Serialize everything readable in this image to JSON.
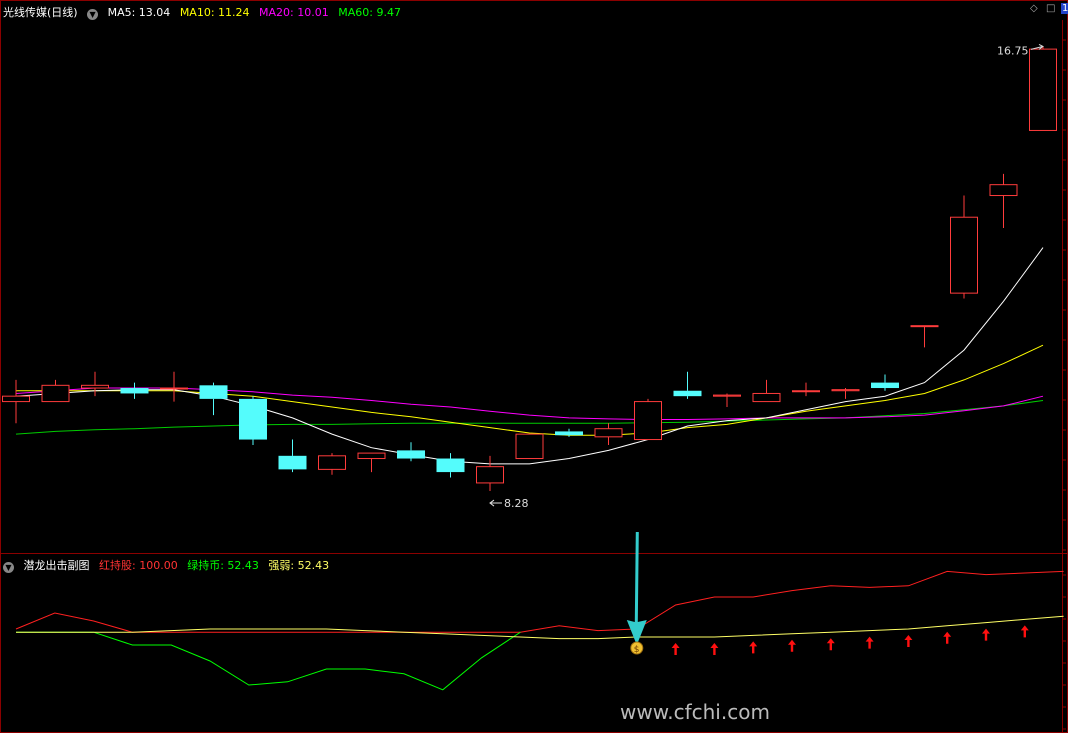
{
  "main": {
    "title": "光线传媒(日线)",
    "ma_labels": [
      {
        "text": "MA5: 13.04",
        "color": "#ffffff"
      },
      {
        "text": "MA10: 11.24",
        "color": "#ffff00"
      },
      {
        "text": "MA20: 10.01",
        "color": "#ff00ff"
      },
      {
        "text": "MA60: 9.47",
        "color": "#00ff00"
      }
    ],
    "high_label": "16.75",
    "low_label": "8.28",
    "controls": {
      "diamond": "◇",
      "window": "□",
      "badge": "1"
    }
  },
  "sub": {
    "title": "潜龙出击副图",
    "labels": [
      {
        "text": "红持股: 100.00",
        "color": "#ff3333"
      },
      {
        "text": "绿持币: 52.43",
        "color": "#00ff00"
      },
      {
        "text": "强弱: 52.43",
        "color": "#ffff66"
      }
    ],
    "signal_icon": "money-bag-icon"
  },
  "watermark": "www.cfchi.com",
  "colors": {
    "up": "#ff3c3c",
    "down": "#54fcfc",
    "ma5": "#ffffff",
    "ma10": "#ffff00",
    "ma20": "#ff00ff",
    "ma60": "#00cc00",
    "arrow": "#33cccc"
  },
  "chart_data": {
    "type": "candlestick",
    "price_range": [
      7.5,
      17.2
    ],
    "candles": [
      {
        "o": 10.2,
        "h": 10.6,
        "l": 9.8,
        "c": 10.3
      },
      {
        "o": 10.2,
        "h": 10.6,
        "l": 10.2,
        "c": 10.5
      },
      {
        "o": 10.45,
        "h": 10.75,
        "l": 10.3,
        "c": 10.5
      },
      {
        "o": 10.45,
        "h": 10.55,
        "l": 10.25,
        "c": 10.35
      },
      {
        "o": 10.45,
        "h": 10.75,
        "l": 10.2,
        "c": 10.45
      },
      {
        "o": 10.5,
        "h": 10.55,
        "l": 9.95,
        "c": 10.25
      },
      {
        "o": 10.25,
        "h": 10.3,
        "l": 9.4,
        "c": 9.5
      },
      {
        "o": 9.2,
        "h": 9.5,
        "l": 8.9,
        "c": 8.95
      },
      {
        "o": 8.95,
        "h": 9.25,
        "l": 8.85,
        "c": 9.2
      },
      {
        "o": 9.15,
        "h": 9.25,
        "l": 8.9,
        "c": 9.25
      },
      {
        "o": 9.3,
        "h": 9.45,
        "l": 9.1,
        "c": 9.15
      },
      {
        "o": 9.15,
        "h": 9.25,
        "l": 8.8,
        "c": 8.9
      },
      {
        "o": 8.7,
        "h": 9.2,
        "l": 8.55,
        "c": 9.0
      },
      {
        "o": 9.15,
        "h": 9.6,
        "l": 9.15,
        "c": 9.6
      },
      {
        "o": 9.65,
        "h": 9.7,
        "l": 9.55,
        "c": 9.58
      },
      {
        "o": 9.55,
        "h": 9.8,
        "l": 9.4,
        "c": 9.7
      },
      {
        "o": 9.5,
        "h": 10.25,
        "l": 9.5,
        "c": 10.2
      },
      {
        "o": 10.4,
        "h": 10.75,
        "l": 10.25,
        "c": 10.3
      },
      {
        "o": 10.3,
        "h": 10.35,
        "l": 10.1,
        "c": 10.32
      },
      {
        "o": 10.2,
        "h": 10.6,
        "l": 10.2,
        "c": 10.35
      },
      {
        "o": 10.4,
        "h": 10.55,
        "l": 10.3,
        "c": 10.4
      },
      {
        "o": 10.4,
        "h": 10.45,
        "l": 10.25,
        "c": 10.42
      },
      {
        "o": 10.55,
        "h": 10.7,
        "l": 10.4,
        "c": 10.45
      },
      {
        "o": 11.6,
        "h": 11.6,
        "l": 11.2,
        "c": 11.6
      },
      {
        "o": 12.2,
        "h": 14.0,
        "l": 12.1,
        "c": 13.6
      },
      {
        "o": 14.0,
        "h": 14.4,
        "l": 13.4,
        "c": 14.2
      },
      {
        "o": 15.2,
        "h": 16.75,
        "l": 15.2,
        "c": 16.7
      }
    ],
    "ma5": [
      10.3,
      10.35,
      10.4,
      10.42,
      10.42,
      10.3,
      10.12,
      9.9,
      9.6,
      9.35,
      9.22,
      9.1,
      9.05,
      9.05,
      9.15,
      9.3,
      9.5,
      9.75,
      9.85,
      9.9,
      10.05,
      10.2,
      10.3,
      10.55,
      11.15,
      12.05,
      13.04
    ],
    "ma10": [
      10.4,
      10.4,
      10.4,
      10.4,
      10.4,
      10.35,
      10.3,
      10.2,
      10.1,
      10.0,
      9.92,
      9.82,
      9.72,
      9.62,
      9.58,
      9.58,
      9.62,
      9.72,
      9.78,
      9.9,
      10.02,
      10.12,
      10.22,
      10.35,
      10.6,
      10.9,
      11.24
    ],
    "ma20": [
      10.35,
      10.4,
      10.45,
      10.45,
      10.45,
      10.42,
      10.38,
      10.32,
      10.28,
      10.22,
      10.15,
      10.1,
      10.02,
      9.95,
      9.9,
      9.88,
      9.87,
      9.87,
      9.88,
      9.9,
      9.9,
      9.9,
      9.92,
      9.95,
      10.03,
      10.12,
      10.3
    ],
    "ma60": [
      9.6,
      9.65,
      9.68,
      9.7,
      9.73,
      9.75,
      9.77,
      9.78,
      9.78,
      9.79,
      9.8,
      9.8,
      9.8,
      9.8,
      9.8,
      9.8,
      9.81,
      9.82,
      9.84,
      9.86,
      9.88,
      9.9,
      9.94,
      9.98,
      10.05,
      10.12,
      10.22
    ],
    "sub_range": [
      0,
      100
    ],
    "hold_red": [
      60,
      70,
      65,
      58,
      58,
      58,
      58,
      58,
      58,
      58,
      58,
      58,
      58,
      58,
      62,
      59,
      60,
      75,
      80,
      80,
      84,
      87,
      86,
      87,
      96,
      94,
      95,
      96
    ],
    "cash_green": [
      58,
      58,
      58,
      50,
      50,
      40,
      25,
      27,
      35,
      35,
      32,
      22,
      42,
      58,
      null,
      null,
      null,
      null,
      null,
      null,
      null,
      null,
      null,
      null,
      null,
      null,
      null,
      null
    ],
    "strength": [
      58,
      58,
      58,
      58,
      59,
      60,
      60,
      60,
      60,
      59,
      58,
      57,
      56,
      55,
      54,
      54,
      55,
      55,
      55,
      56,
      57,
      58,
      59,
      60,
      62,
      64,
      66,
      68
    ],
    "buy_arrow_index": 16,
    "signal_indices": [
      17,
      18,
      19,
      20,
      21,
      22,
      23,
      24,
      25,
      26
    ]
  }
}
